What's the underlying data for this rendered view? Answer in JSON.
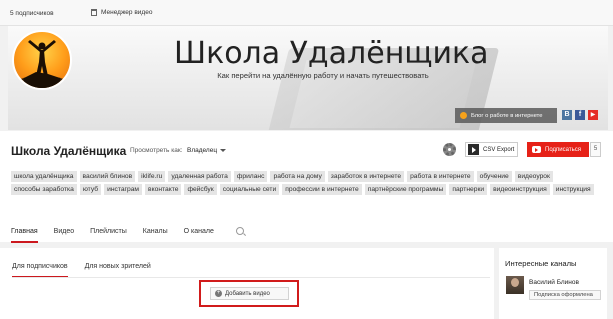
{
  "topbar": {
    "subscribers": "5 подписчиков",
    "video_manager": "Менеджер видео"
  },
  "banner": {
    "title": "Школа Удалёнщика",
    "subtitle": "Как перейти на удалённую работу и начать путешествовать",
    "blog_link": "Блог о работе в интернете",
    "social": {
      "vk": "В",
      "fb": "f",
      "yt": "▶"
    }
  },
  "header": {
    "channel_name": "Школа Удалёнщика",
    "view_as_label": "Просмотреть как:",
    "view_as_value": "Владелец",
    "csv_label": "CSV Export",
    "subscribe_label": "Подписаться",
    "subscribe_count": "5"
  },
  "tags": [
    "школа удалёнщика",
    "василий блинов",
    "iklife.ru",
    "удаленная работа",
    "фриланс",
    "работа на дому",
    "заработок в интернете",
    "работа в интернете",
    "обучение",
    "видеоурок",
    "способы заработка",
    "ютуб",
    "инстаграм",
    "вконтакте",
    "фейсбук",
    "социальные сети",
    "профессии в интернете",
    "партнёрские программы",
    "партнерки",
    "видеоинструкция",
    "инструкция"
  ],
  "tabs": [
    {
      "label": "Главная",
      "active": true
    },
    {
      "label": "Видео",
      "active": false
    },
    {
      "label": "Плейлисты",
      "active": false
    },
    {
      "label": "Каналы",
      "active": false
    },
    {
      "label": "О канале",
      "active": false
    }
  ],
  "main": {
    "subtabs": [
      {
        "label": "Для подписчиков",
        "active": true
      },
      {
        "label": "Для новых зрителей",
        "active": false
      }
    ],
    "add_video_label": "Добавить видео"
  },
  "side": {
    "title": "Интересные каналы",
    "channel_name": "Василий Блинов",
    "subscribed_label": "Подписка оформлена"
  },
  "colors": {
    "accent_red": "#cc181e",
    "subscribe_red": "#e62117",
    "highlight_frame": "#d11b1b",
    "logo_orange": "#ff9d1a"
  }
}
